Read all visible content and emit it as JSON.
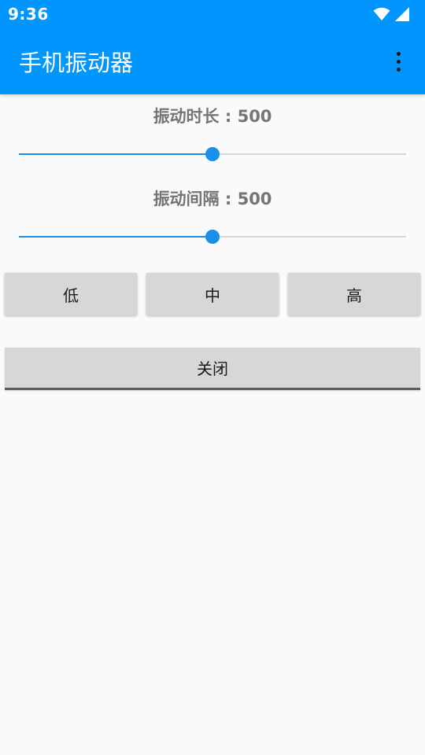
{
  "status_bar": {
    "time": "9:36"
  },
  "app_bar": {
    "title": "手机振动器"
  },
  "controls": {
    "duration": {
      "label": "振动时长 : 500",
      "value": 500,
      "fraction": 0.5
    },
    "interval": {
      "label": "振动间隔 : 500",
      "value": 500,
      "fraction": 0.5
    }
  },
  "buttons": {
    "low": "低",
    "medium": "中",
    "high": "高",
    "close": "关闭"
  },
  "colors": {
    "accent": "#0096fd",
    "slider": "#1a8fe8",
    "button_bg": "#d6d7d7"
  }
}
